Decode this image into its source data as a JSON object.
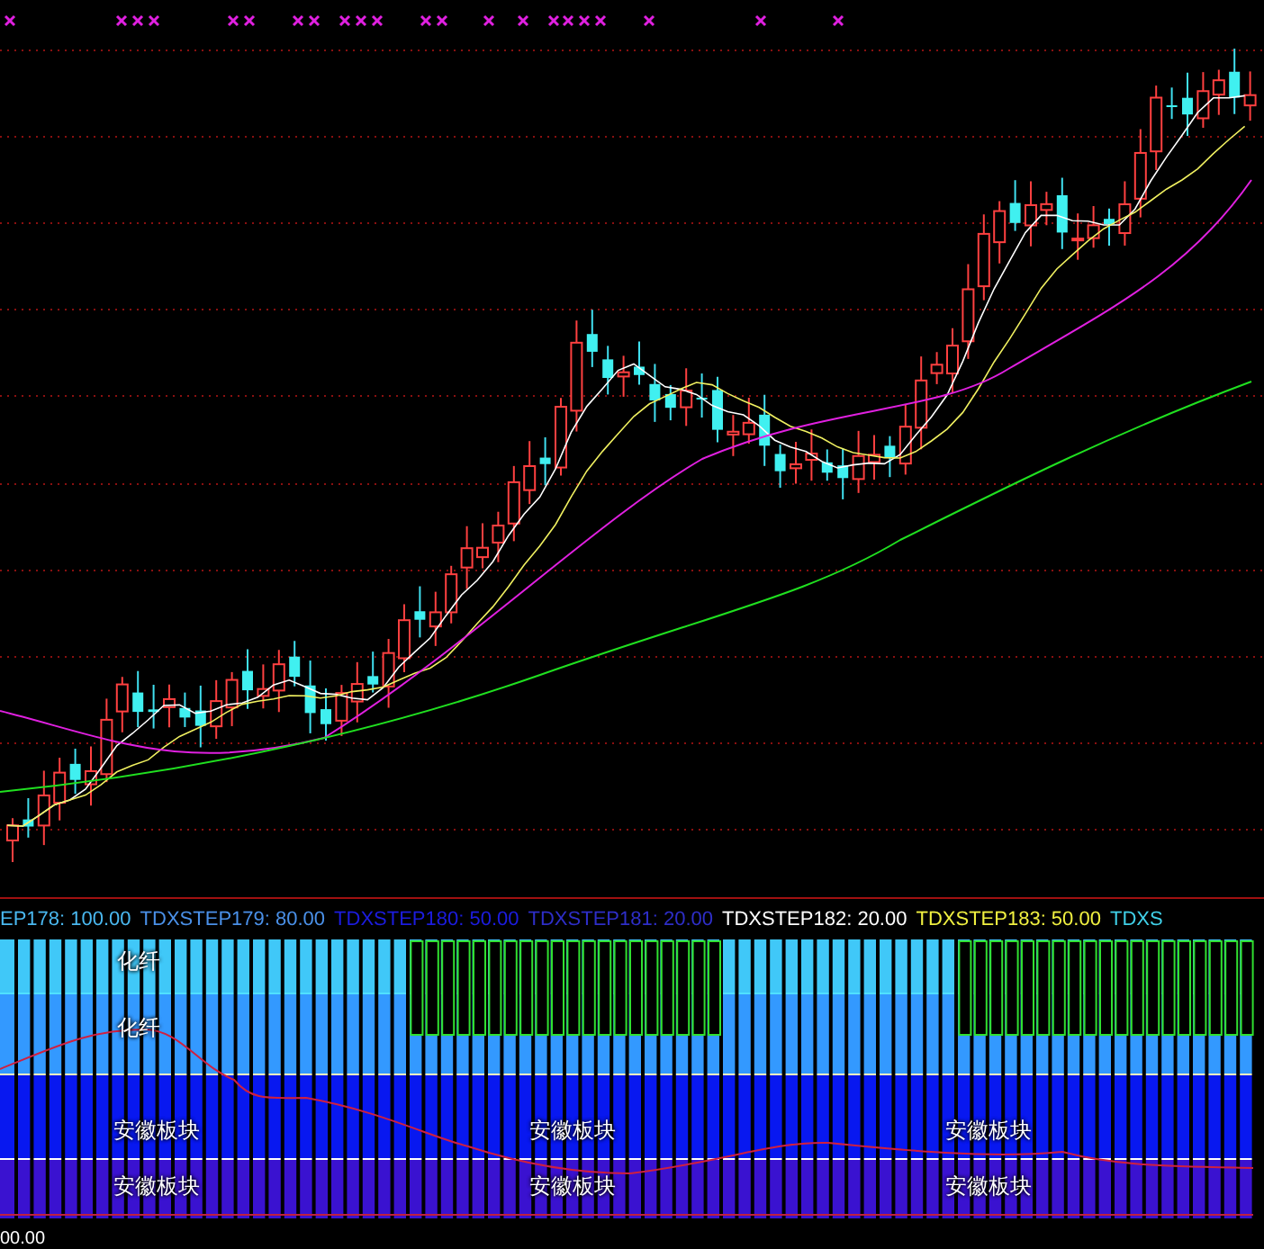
{
  "legend": [
    {
      "text": "EP178: 100.00",
      "color": "#4ab8f0"
    },
    {
      "text": "TDXSTEP179: 80.00",
      "color": "#4a90e8"
    },
    {
      "text": "TDXSTEP180: 50.00",
      "color": "#1c1ce0"
    },
    {
      "text": "TDXSTEP181: 20.00",
      "color": "#2e2ec8"
    },
    {
      "text": "TDXSTEP182: 20.00",
      "color": "#ffffff"
    },
    {
      "text": "TDXSTEP183: 50.00",
      "color": "#f0f040"
    },
    {
      "text": "TDXS",
      "color": "#40d0e8"
    }
  ],
  "indicator_panel": {
    "upper_labels": [
      "化纤",
      "化纤"
    ],
    "sector_rows": [
      {
        "labels": [
          "安徽板块",
          "安徽板块",
          "安徽板块"
        ]
      },
      {
        "labels": [
          "安徽板块",
          "安徽板块",
          "安徽板块"
        ]
      }
    ]
  },
  "bottom_value": "00.00"
}
